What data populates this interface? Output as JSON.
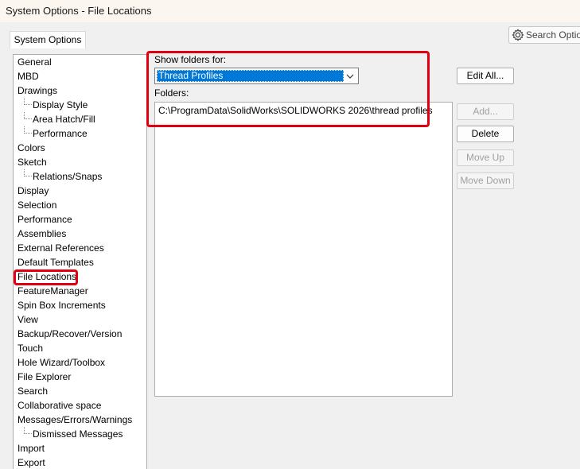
{
  "window": {
    "title": "System Options - File Locations"
  },
  "tab": {
    "label": "System Options"
  },
  "search": {
    "label": "Search Options",
    "icon": "gear-icon"
  },
  "tree": {
    "items": [
      {
        "label": "General",
        "level": 0
      },
      {
        "label": "MBD",
        "level": 0
      },
      {
        "label": "Drawings",
        "level": 0
      },
      {
        "label": "Display Style",
        "level": 1
      },
      {
        "label": "Area Hatch/Fill",
        "level": 1
      },
      {
        "label": "Performance",
        "level": 1
      },
      {
        "label": "Colors",
        "level": 0
      },
      {
        "label": "Sketch",
        "level": 0
      },
      {
        "label": "Relations/Snaps",
        "level": 1
      },
      {
        "label": "Display",
        "level": 0
      },
      {
        "label": "Selection",
        "level": 0
      },
      {
        "label": "Performance",
        "level": 0
      },
      {
        "label": "Assemblies",
        "level": 0
      },
      {
        "label": "External References",
        "level": 0
      },
      {
        "label": "Default Templates",
        "level": 0
      },
      {
        "label": "File Locations",
        "level": 0,
        "selected": true
      },
      {
        "label": "FeatureManager",
        "level": 0
      },
      {
        "label": "Spin Box Increments",
        "level": 0
      },
      {
        "label": "View",
        "level": 0
      },
      {
        "label": "Backup/Recover/Version",
        "level": 0
      },
      {
        "label": "Touch",
        "level": 0
      },
      {
        "label": "Hole Wizard/Toolbox",
        "level": 0
      },
      {
        "label": "File Explorer",
        "level": 0
      },
      {
        "label": "Search",
        "level": 0
      },
      {
        "label": "Collaborative space",
        "level": 0
      },
      {
        "label": "Messages/Errors/Warnings",
        "level": 0
      },
      {
        "label": "Dismissed Messages",
        "level": 1
      },
      {
        "label": "Import",
        "level": 0
      },
      {
        "label": "Export",
        "level": 0
      }
    ]
  },
  "show_folders": {
    "label": "Show folders for:",
    "selected": "Thread Profiles"
  },
  "folders": {
    "label": "Folders:",
    "items": [
      "C:\\ProgramData\\SolidWorks\\SOLIDWORKS 2026\\thread profiles"
    ]
  },
  "buttons": {
    "edit_all": "Edit All...",
    "add": "Add...",
    "delete": "Delete",
    "move_up": "Move Up",
    "move_down": "Move Down"
  },
  "colors": {
    "highlight": "#e00010",
    "selection": "#0078d7"
  }
}
